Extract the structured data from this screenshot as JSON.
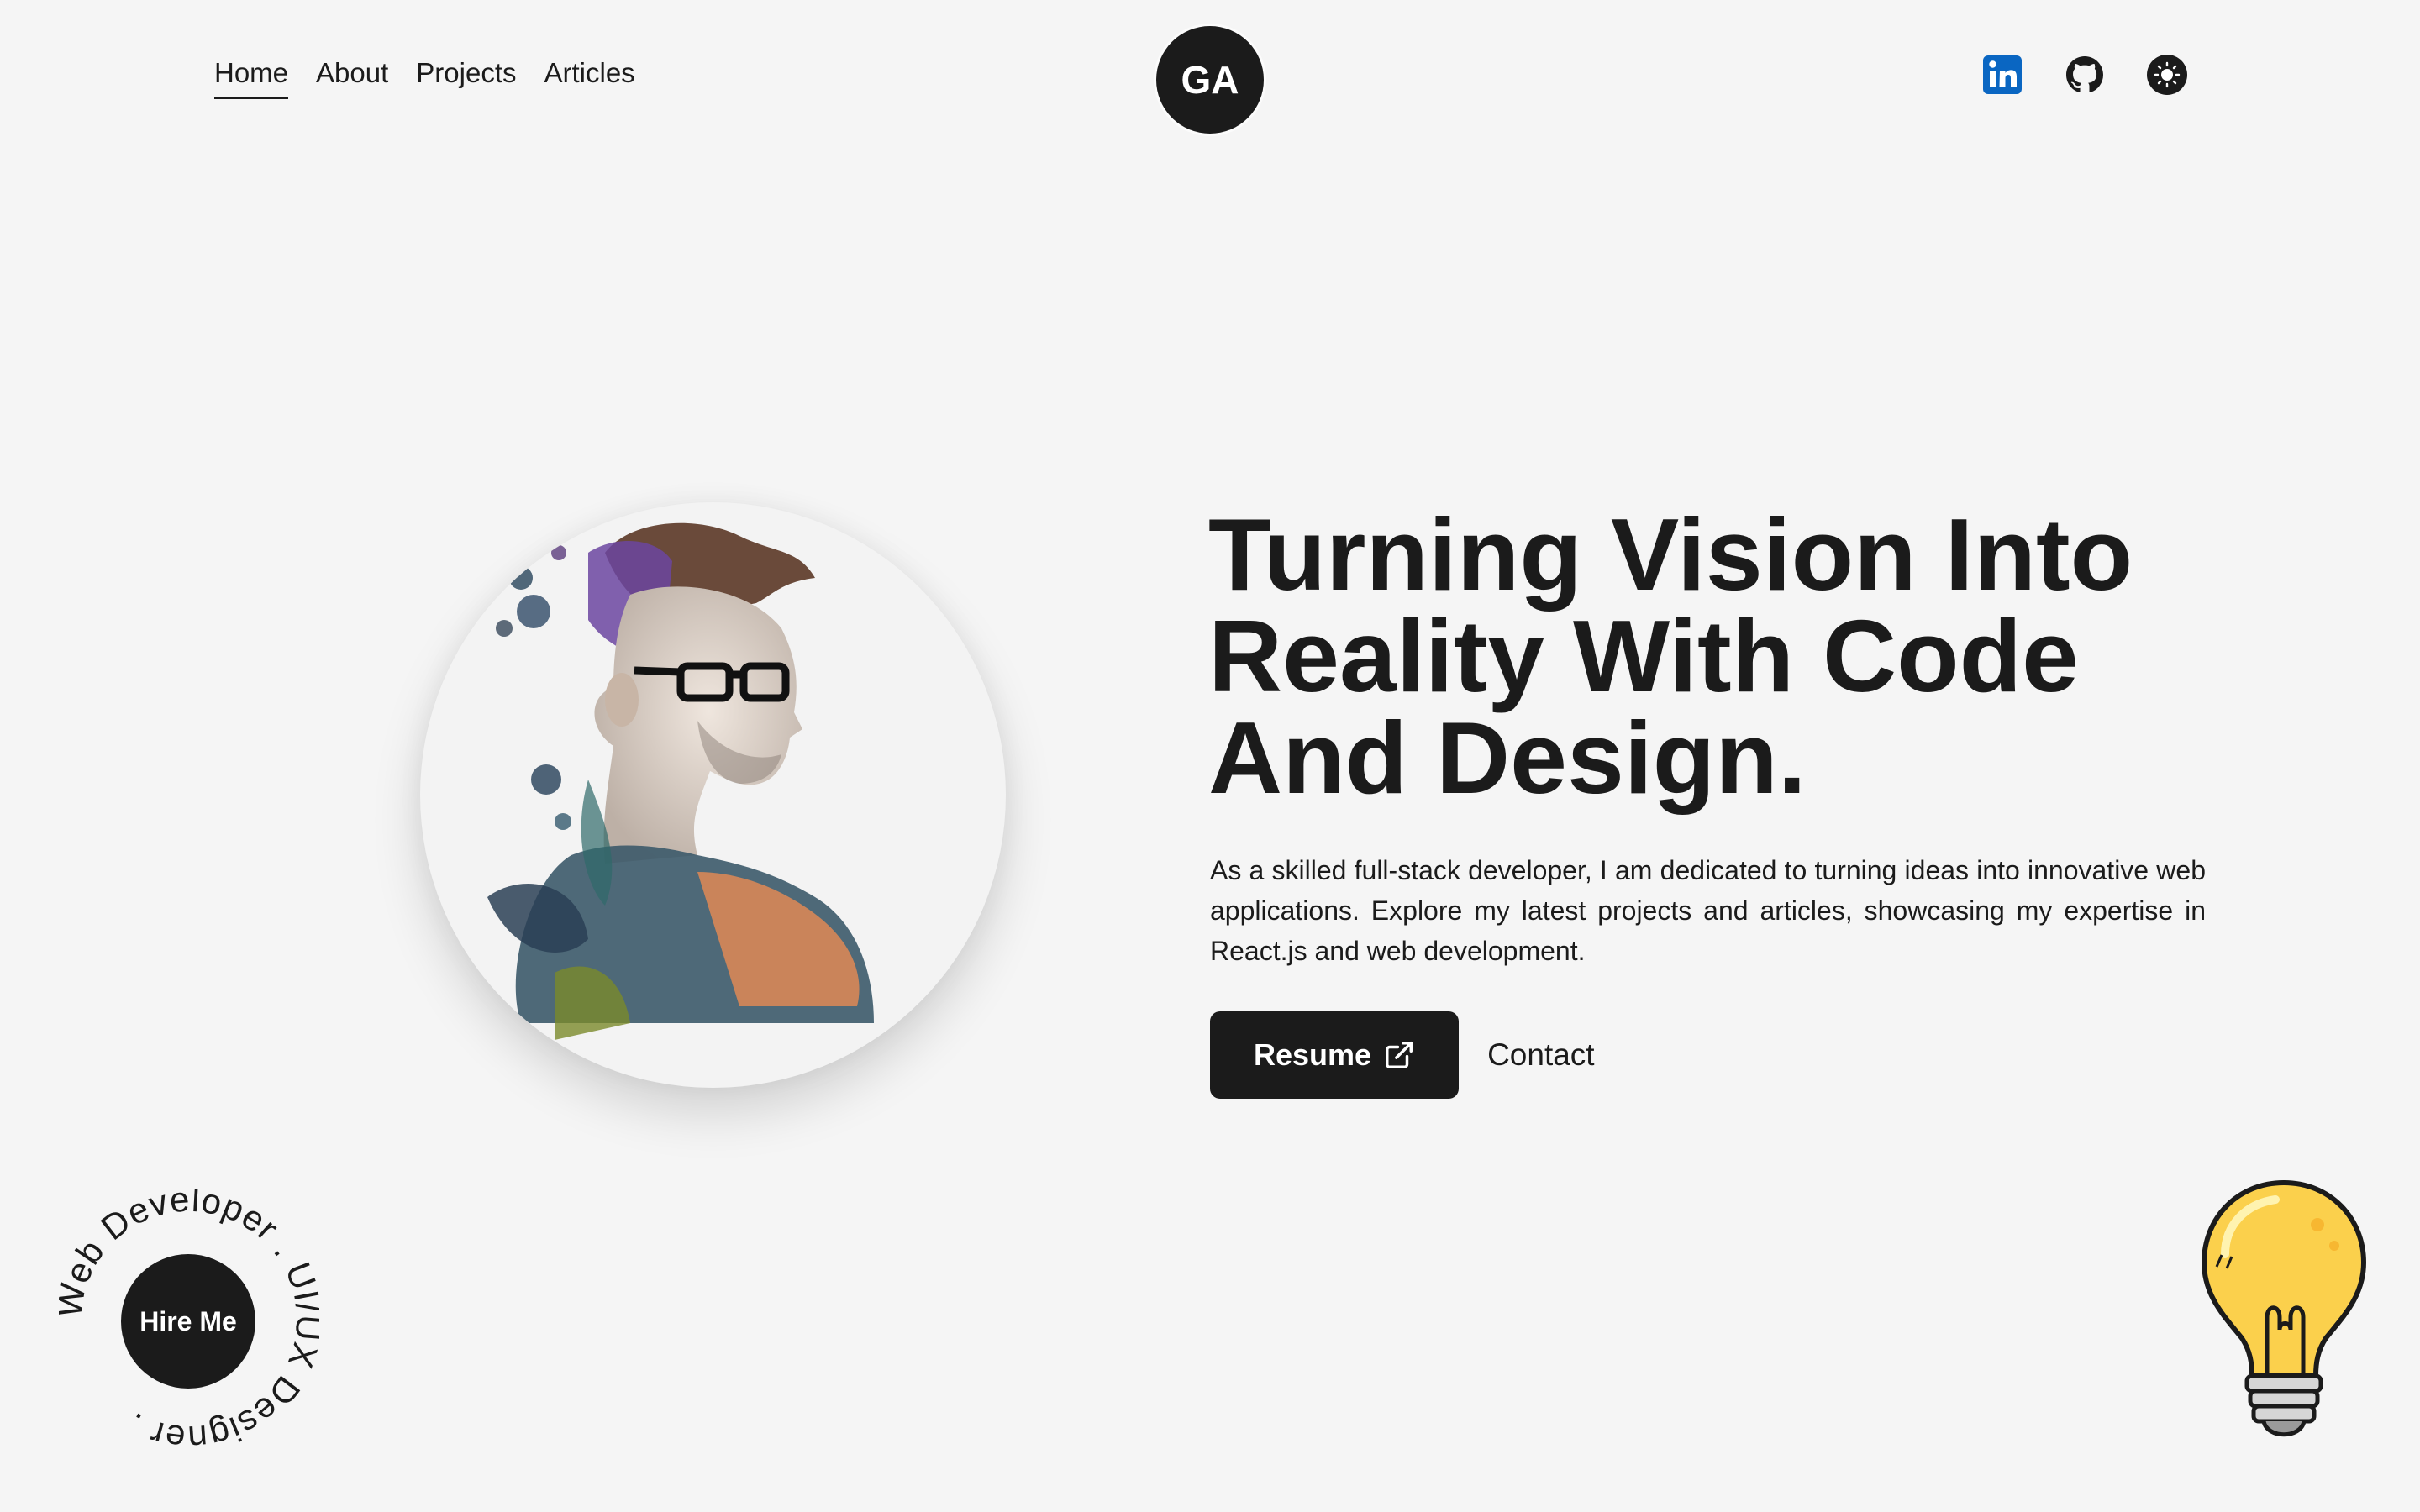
{
  "nav": {
    "items": [
      {
        "label": "Home",
        "active": true
      },
      {
        "label": "About",
        "active": false
      },
      {
        "label": "Projects",
        "active": false
      },
      {
        "label": "Articles",
        "active": false
      }
    ]
  },
  "logo": {
    "text": "GA"
  },
  "socials": {
    "icons": [
      "linkedin-icon",
      "github-icon",
      "theme-toggle-icon"
    ],
    "linkedin_color": "#0a66c2"
  },
  "hero": {
    "headline": "Turning Vision Into Reality With Code And Design.",
    "intro": "As a skilled full-stack developer, I am dedicated to turning ideas into innovative web applications. Explore my latest projects and articles, showcasing my expertise in React.js and web development.",
    "resume_label": "Resume",
    "contact_label": "Contact"
  },
  "hire": {
    "button_label": "Hire Me",
    "ring_text": "Web Developer . UI/UX Designer . "
  },
  "colors": {
    "background": "#f5f5f5",
    "dark": "#1b1b1b"
  }
}
